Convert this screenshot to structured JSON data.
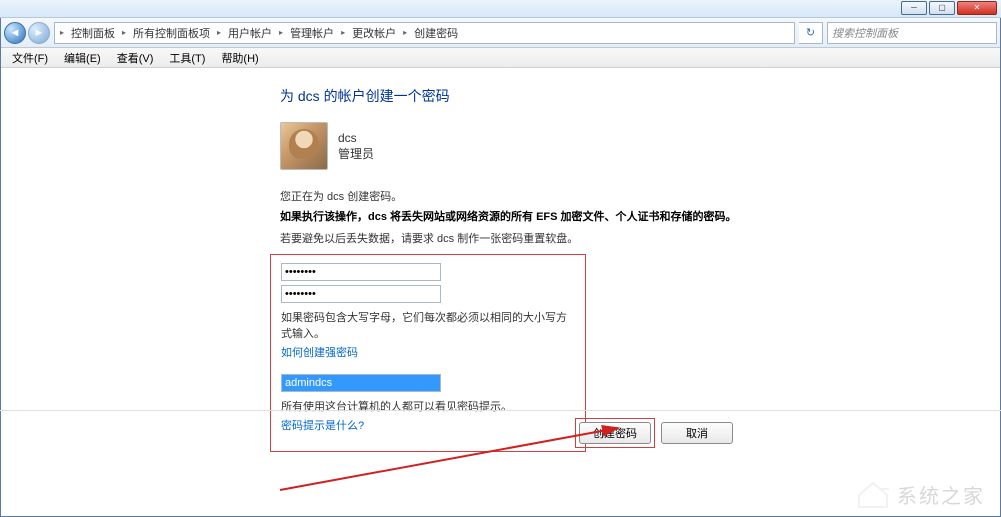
{
  "breadcrumb": {
    "items": [
      "控制面板",
      "所有控制面板项",
      "用户帐户",
      "管理帐户",
      "更改帐户",
      "创建密码"
    ]
  },
  "search": {
    "placeholder": "搜索控制面板"
  },
  "menubar": {
    "file": "文件(F)",
    "edit": "编辑(E)",
    "view": "查看(V)",
    "tools": "工具(T)",
    "help": "帮助(H)"
  },
  "page": {
    "title": "为 dcs 的帐户创建一个密码",
    "username": "dcs",
    "role": "管理员",
    "info1": "您正在为 dcs 创建密码。",
    "info2": "如果执行该操作，dcs 将丢失网站或网络资源的所有 EFS 加密文件、个人证书和存储的密码。",
    "info3": "若要避免以后丢失数据，请要求 dcs 制作一张密码重置软盘。",
    "pw1_value": "••••••••",
    "pw2_value": "••••••••",
    "caps_hint": "如果密码包含大写字母，它们每次都必须以相同的大小写方式输入。",
    "strong_link": "如何创建强密码",
    "hint_value": "admindcs",
    "hint_desc": "所有使用这台计算机的人都可以看见密码提示。",
    "hint_link": "密码提示是什么?"
  },
  "buttons": {
    "create": "创建密码",
    "cancel": "取消"
  },
  "watermark": "系统之家"
}
